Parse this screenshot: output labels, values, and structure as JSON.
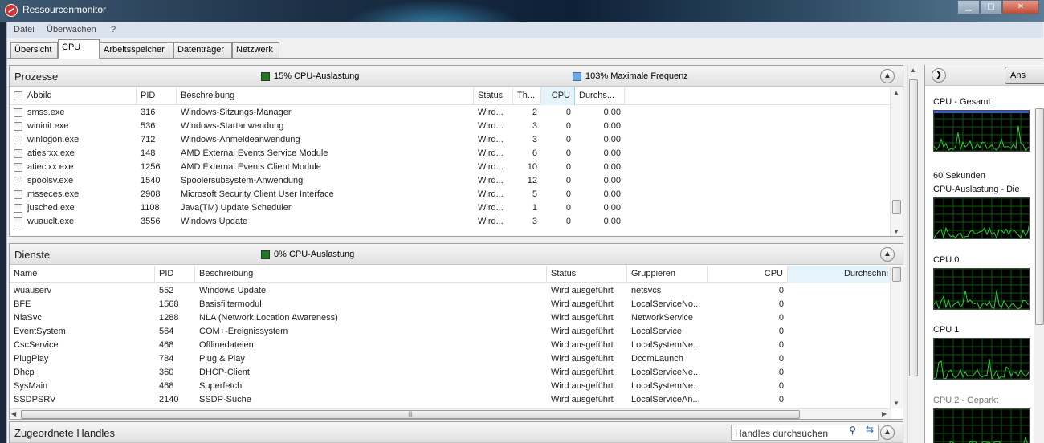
{
  "window": {
    "title": "Ressourcenmonitor",
    "buttons": [
      "▁",
      "▢",
      "✕"
    ]
  },
  "menu": [
    "Datei",
    "Überwachen",
    "?"
  ],
  "tabs": [
    "Übersicht",
    "CPU",
    "Arbeitsspeicher",
    "Datenträger",
    "Netzwerk"
  ],
  "active_tab": "CPU",
  "prozesse": {
    "title": "Prozesse",
    "indicators": [
      {
        "label": "15% CPU-Auslastung",
        "color": "#1f7a1f"
      },
      {
        "label": "103% Maximale Frequenz",
        "color": "#6fa8e8"
      }
    ],
    "columns": [
      "Abbild",
      "PID",
      "Beschreibung",
      "Status",
      "Th...",
      "CPU",
      "Durchs..."
    ],
    "rows": [
      [
        "smss.exe",
        "316",
        "Windows-Sitzungs-Manager",
        "Wird...",
        "2",
        "0",
        "0.00"
      ],
      [
        "wininit.exe",
        "536",
        "Windows-Startanwendung",
        "Wird...",
        "3",
        "0",
        "0.00"
      ],
      [
        "winlogon.exe",
        "712",
        "Windows-Anmeldeanwendung",
        "Wird...",
        "3",
        "0",
        "0.00"
      ],
      [
        "atiesrxx.exe",
        "148",
        "AMD External Events Service Module",
        "Wird...",
        "6",
        "0",
        "0.00"
      ],
      [
        "atieclxx.exe",
        "1256",
        "AMD External Events Client Module",
        "Wird...",
        "10",
        "0",
        "0.00"
      ],
      [
        "spoolsv.exe",
        "1540",
        "Spoolersubsystem-Anwendung",
        "Wird...",
        "12",
        "0",
        "0.00"
      ],
      [
        "msseces.exe",
        "2908",
        "Microsoft Security Client User Interface",
        "Wird...",
        "5",
        "0",
        "0.00"
      ],
      [
        "jusched.exe",
        "1108",
        "Java(TM) Update Scheduler",
        "Wird...",
        "1",
        "0",
        "0.00"
      ],
      [
        "wuauclt.exe",
        "3556",
        "Windows Update",
        "Wird...",
        "3",
        "0",
        "0.00"
      ]
    ]
  },
  "dienste": {
    "title": "Dienste",
    "indicators": [
      {
        "label": "0% CPU-Auslastung",
        "color": "#1f7a1f"
      }
    ],
    "columns": [
      "Name",
      "PID",
      "Beschreibung",
      "Status",
      "Gruppieren",
      "CPU",
      "Durchschni"
    ],
    "rows": [
      [
        "wuauserv",
        "552",
        "Windows Update",
        "Wird ausgeführt",
        "netsvcs",
        "0"
      ],
      [
        "BFE",
        "1568",
        "Basisfiltermodul",
        "Wird ausgeführt",
        "LocalServiceNo...",
        "0"
      ],
      [
        "NlaSvc",
        "1288",
        "NLA (Network Location Awareness)",
        "Wird ausgeführt",
        "NetworkService",
        "0"
      ],
      [
        "EventSystem",
        "564",
        "COM+-Ereignissystem",
        "Wird ausgeführt",
        "LocalService",
        "0"
      ],
      [
        "CscService",
        "468",
        "Offlinedateien",
        "Wird ausgeführt",
        "LocalSystemNe...",
        "0"
      ],
      [
        "PlugPlay",
        "784",
        "Plug & Play",
        "Wird ausgeführt",
        "DcomLaunch",
        "0"
      ],
      [
        "Dhcp",
        "360",
        "DHCP-Client",
        "Wird ausgeführt",
        "LocalServiceNe...",
        "0"
      ],
      [
        "SysMain",
        "468",
        "Superfetch",
        "Wird ausgeführt",
        "LocalSystemNe...",
        "0"
      ],
      [
        "SSDPSRV",
        "2140",
        "SSDP-Suche",
        "Wird ausgeführt",
        "LocalServiceAn...",
        "0"
      ]
    ]
  },
  "handles": {
    "title": "Zugeordnete Handles",
    "search_placeholder": "Handles durchsuchen"
  },
  "graph_pane": {
    "view_button": "Ans",
    "graphs": [
      {
        "label": "CPU - Gesamt",
        "parked": false
      },
      {
        "label": "CPU-Auslastung - Die",
        "parked": false
      },
      {
        "label": "CPU 0",
        "parked": false
      },
      {
        "label": "CPU 1",
        "parked": false
      },
      {
        "label": "CPU 2 - Geparkt",
        "parked": true
      }
    ],
    "time_label": "60 Sekunden",
    "line_color": "#2ecc40",
    "grid_color": "#0b5a0b"
  },
  "colors": {
    "accent_blue": "#6fa8e8",
    "cpu_green": "#1f7a1f"
  }
}
